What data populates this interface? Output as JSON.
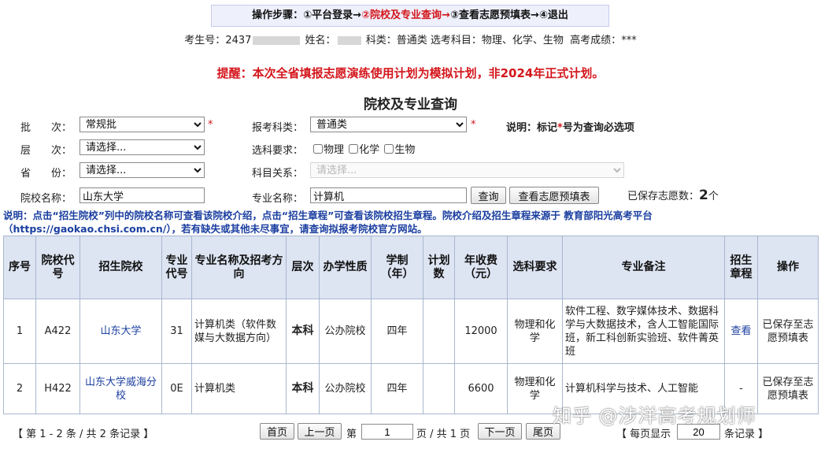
{
  "steps": {
    "prefix": "操作步骤：",
    "step1": "①平台登录→",
    "step2": "②院校及专业查询→",
    "step3": "③查看志愿预填表→",
    "step4": "④退出"
  },
  "candidate": {
    "id_label": "考生号：",
    "id_value": "2437",
    "name_label": "姓名：",
    "subject_type_label": "科类：",
    "subject_type_value": "普通类",
    "elective_label": "选考科目：",
    "elective_value": "物理、化学、生物",
    "score_label": "高考成绩：",
    "score_value": "***"
  },
  "reminder": "提醒：本次全省填报志愿演练使用计划为模拟计划，非2024年正式计划。",
  "page_title": "院校及专业查询",
  "form": {
    "batch_label": "批　　次：",
    "batch_value": "常规批",
    "category_label": "报考科类：",
    "category_value": "普通类",
    "must_note_prefix": "说明：标记",
    "must_note_star": "*",
    "must_note_suffix": "号为查询必选项",
    "level_label": "层　　次：",
    "level_value": "请选择...",
    "req_label": "选科要求：",
    "req_options": [
      "物理",
      "化学",
      "生物"
    ],
    "province_label": "省　　份：",
    "province_value": "请选择...",
    "relation_label": "科目关系：",
    "relation_value": "请选择...",
    "school_label": "院校名称：",
    "school_value": "山东大学",
    "major_label": "专业名称：",
    "major_value": "计算机",
    "query_button": "查询",
    "view_table_button": "查看志愿预填表",
    "saved_label": "已保存志愿数：",
    "saved_count": "2",
    "saved_unit": "个",
    "star": "*"
  },
  "blue_note_line1": "说明：点击“招生院校”列中的院校名称可查看该院校介绍，点击“招生章程”可查看该院校招生章程。院校介绍及招生章程来源于 教育部阳光高考平台",
  "blue_note_line2": "（https://gaokao.chsi.com.cn/），若有缺失或其他未尽事宜，请查询拟报考院校官方网站。",
  "table": {
    "headers": [
      "序号",
      "院校代号",
      "招生院校",
      "专业代号",
      "专业名称及招考方向",
      "层次",
      "办学性质",
      "学制（年）",
      "计划数",
      "年收费（元）",
      "选科要求",
      "专业备注",
      "招生章程",
      "操作"
    ],
    "rows": [
      {
        "no": "1",
        "code": "A422",
        "school": "山东大学",
        "major_code": "31",
        "major": "计算机类（软件数媒与大数据方向）",
        "level": "本科",
        "nature": "公办院校",
        "years": "四年",
        "plan": "",
        "fee": "12000",
        "req": "物理和化学",
        "remark": "软件工程、数字媒体技术、数据科学与大数据技术，含人工智能国际班，新工科创新实验班、软件菁英班",
        "charter": "查看",
        "action": "已保存至志愿预填表"
      },
      {
        "no": "2",
        "code": "H422",
        "school": "山东大学威海分校",
        "major_code": "0E",
        "major": "计算机类",
        "level": "本科",
        "nature": "公办院校",
        "years": "四年",
        "plan": "",
        "fee": "6600",
        "req": "物理和化学",
        "remark": "计算机科学与技术、人工智能",
        "charter": "-",
        "action": "已保存至志愿预填表"
      }
    ]
  },
  "pager": {
    "summary": "【 第 1 - 2 条 / 共 2 条记录 】",
    "first": "首页",
    "prev": "上一页",
    "page_label": "第",
    "page_value": "1",
    "page_total": "页 / 共 1 页",
    "next": "下一页",
    "last": "尾页",
    "per_page_label": "【 每页显示",
    "per_page_value": "20",
    "per_page_suffix": "条记录 】"
  },
  "watermark": "知乎 @涉洋高考规划师"
}
